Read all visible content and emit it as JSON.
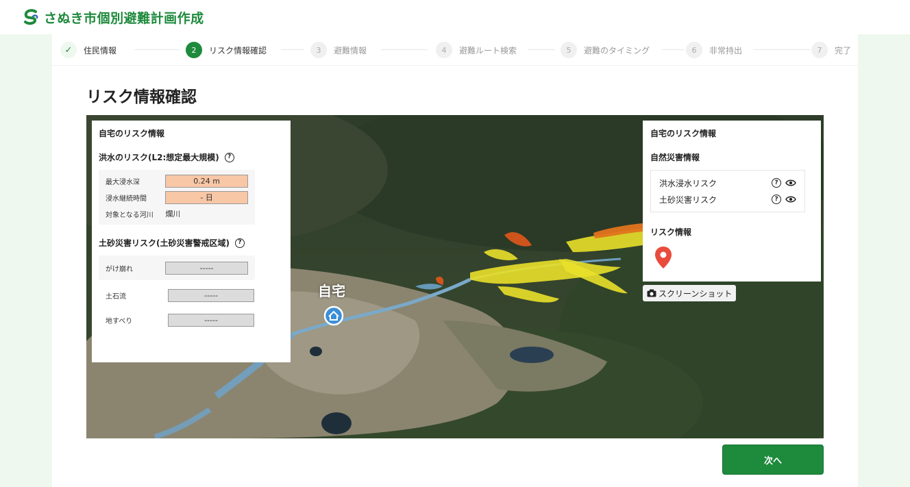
{
  "header": {
    "title": "さぬき市個別避難計画作成",
    "logo_icon": "sanuki-city-logo-icon"
  },
  "stepper": [
    {
      "num": "✓",
      "label": "住民情報",
      "state": "done"
    },
    {
      "num": "2",
      "label": "リスク情報確認",
      "state": "active"
    },
    {
      "num": "3",
      "label": "避難情報",
      "state": "todo"
    },
    {
      "num": "4",
      "label": "避難ルート検索",
      "state": "todo"
    },
    {
      "num": "5",
      "label": "避難のタイミング",
      "state": "todo"
    },
    {
      "num": "6",
      "label": "非常持出",
      "state": "todo"
    },
    {
      "num": "7",
      "label": "完了",
      "state": "todo"
    }
  ],
  "page_title": "リスク情報確認",
  "left_card": {
    "title": "自宅のリスク情報",
    "flood": {
      "title": "洪水のリスク(L2:想定最大規模)",
      "rows": [
        {
          "label": "最大浸水深",
          "value": "0.24 m"
        },
        {
          "label": "浸水継続時間",
          "value": "- 日"
        },
        {
          "label": "対象となる河川",
          "value": "爛川"
        }
      ]
    },
    "landslide": {
      "title": "土砂災害リスク(土砂災害警戒区域)",
      "rows": [
        {
          "label": "がけ崩れ",
          "value": "-----"
        },
        {
          "label": "土石流",
          "value": "-----"
        },
        {
          "label": "地すべり",
          "value": "-----"
        }
      ]
    }
  },
  "right_card": {
    "title": "自宅のリスク情報",
    "hazard_title": "自然災害情報",
    "hazards": [
      {
        "label": "洪水浸水リスク"
      },
      {
        "label": "土砂災害リスク"
      }
    ],
    "risk_title": "リスク情報"
  },
  "map": {
    "home_label": "自宅",
    "screenshot_label": "スクリーンショット"
  },
  "next_button": "次へ",
  "colors": {
    "brand_green": "#1e8a3c",
    "warn_fill": "#f8c7a6",
    "na_fill": "#dcdcdc",
    "marker_red": "#e94b3c"
  }
}
